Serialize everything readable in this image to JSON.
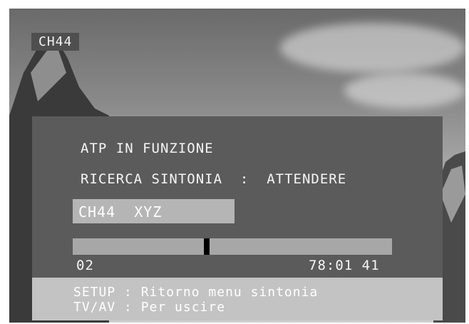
{
  "channel_badge": "CH44",
  "osd": {
    "status_line": "ATP IN FUNZIONE",
    "search_line": "RICERCA SINTONIA  :  ATTENDERE",
    "channel_field": "CH44  XYZ",
    "progress": {
      "fraction": 0.42,
      "start_label": "02",
      "end_label": "78:01 41"
    }
  },
  "help": {
    "line1": "SETUP : Ritorno menu sintonia",
    "line2": "TV/AV : Per uscire"
  },
  "colors": {
    "panel": "#5b5b5b",
    "field": "#b5b5b5",
    "track": "#a7a7a7",
    "help_bar": "#c3c3c3"
  }
}
